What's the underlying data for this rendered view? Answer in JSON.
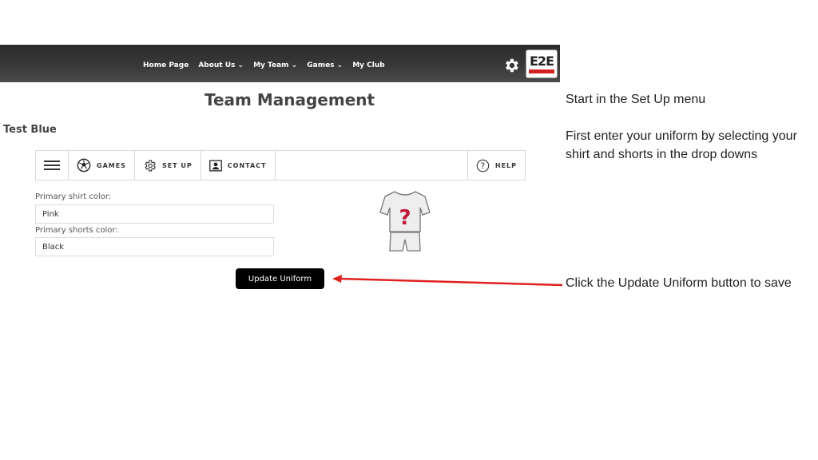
{
  "header": {
    "nav": [
      "Home Page",
      "About Us ⌄",
      "My Team ⌄",
      "Games ⌄",
      "My Club"
    ],
    "settings_icon": "gear-icon",
    "logo_text": "E2E"
  },
  "page": {
    "title": "Team Management",
    "team_name": "Test Blue"
  },
  "toolbar": {
    "menu_icon": "hamburger-icon",
    "games": "GAMES",
    "setup": "SET UP",
    "contact": "CONTACT",
    "help": "HELP"
  },
  "form": {
    "shirt_label": "Primary shirt color:",
    "shirt_value": "Pink",
    "shorts_label": "Primary shorts color:",
    "shorts_value": "Black",
    "update_button": "Update Uniform"
  },
  "annotations": {
    "note1": "Start in the Set Up menu",
    "note2": "First enter your uniform by selecting your shirt and shorts in the drop downs",
    "note3": "Click the Update Uniform button to save"
  },
  "colors": {
    "arrow": "#e02020",
    "topbar": "#333333"
  }
}
